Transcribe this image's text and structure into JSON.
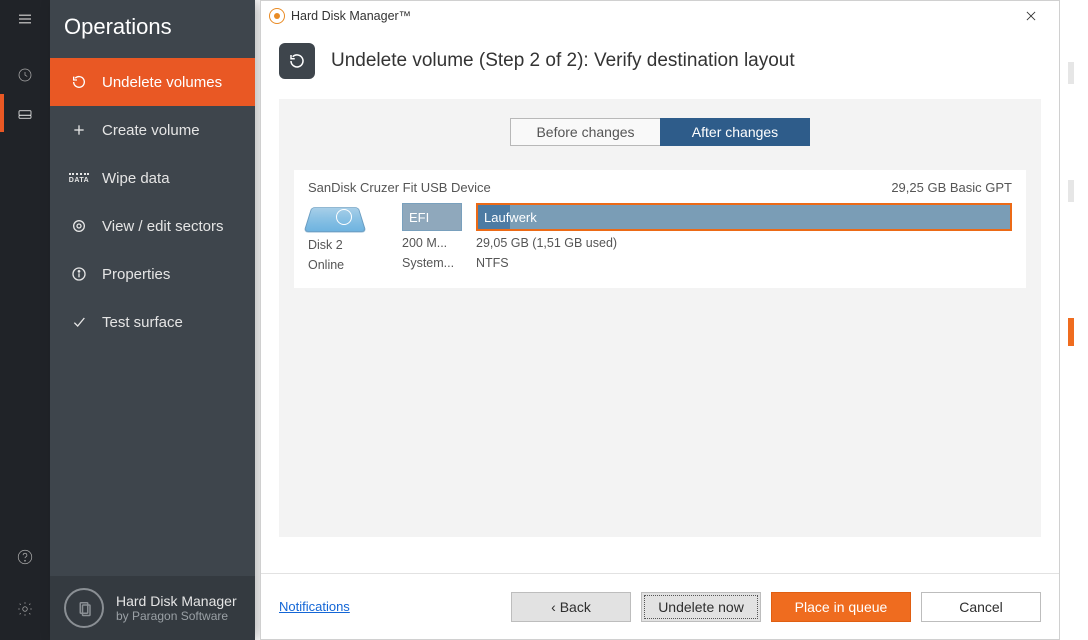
{
  "sidebar": {
    "title": "Operations",
    "items": [
      {
        "label": "Undelete volumes",
        "icon": "undelete-icon",
        "active": true
      },
      {
        "label": "Create volume",
        "icon": "plus-icon",
        "active": false
      },
      {
        "label": "Wipe data",
        "icon": "data-icon",
        "active": false
      },
      {
        "label": "View / edit sectors",
        "icon": "target-icon",
        "active": false
      },
      {
        "label": "Properties",
        "icon": "info-icon",
        "active": false
      },
      {
        "label": "Test surface",
        "icon": "check-icon",
        "active": false
      }
    ],
    "footer": {
      "app_name": "Hard Disk Manager",
      "by_line": "by Paragon Software"
    }
  },
  "dialog": {
    "window_title": "Hard Disk Manager™",
    "heading": "Undelete volume (Step 2 of 2): Verify destination layout",
    "tabs": {
      "before": "Before changes",
      "after": "After changes",
      "active": "after"
    },
    "device": {
      "name": "SanDisk Cruzer Fit USB Device",
      "size_type": "29,25 GB Basic GPT",
      "disk_label": "Disk 2",
      "disk_status": "Online",
      "efi_label": "EFI",
      "efi_sub1": "200 M...",
      "efi_sub2": "System...",
      "vol_name": "Laufwerk",
      "vol_sub1": "29,05 GB (1,51 GB used)",
      "vol_sub2": "NTFS"
    },
    "footer": {
      "notifications": "Notifications",
      "back": "‹ Back",
      "undelete": "Undelete now",
      "queue": "Place in queue",
      "cancel": "Cancel"
    }
  }
}
